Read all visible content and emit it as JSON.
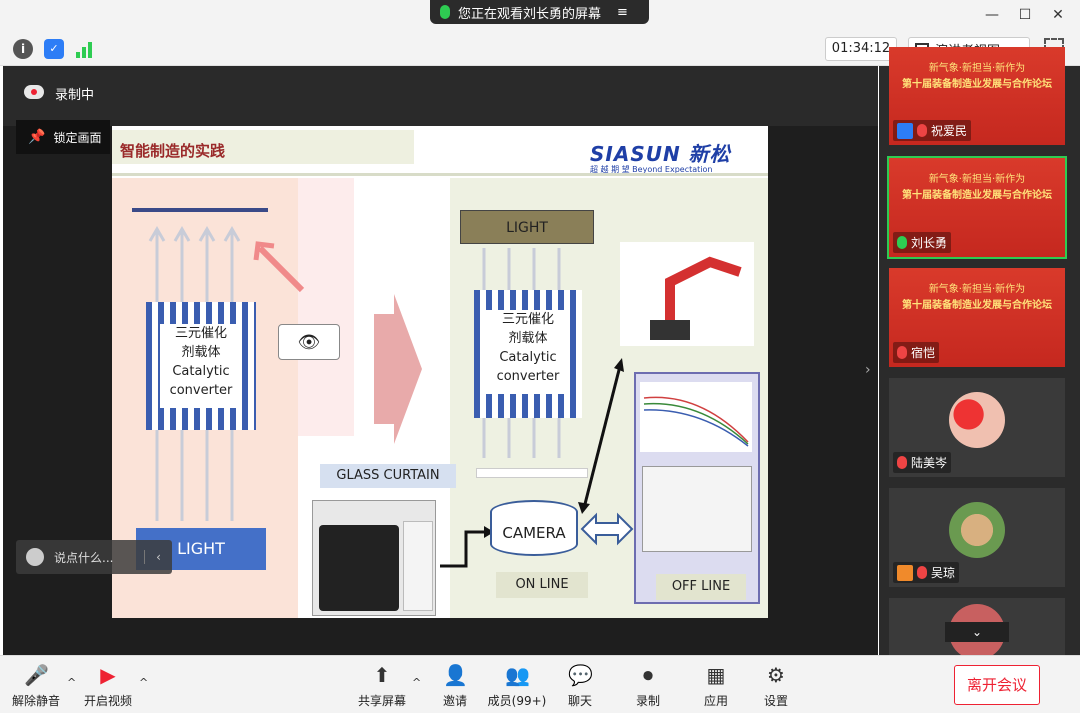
{
  "window": {
    "sharing_text": "您正在观看刘长勇的屏幕",
    "menu_icon": "≡",
    "minimize": "—",
    "maximize": "☐",
    "close": "✕"
  },
  "toolbar": {
    "timer": "01:34:12",
    "view_label": "演讲者视图",
    "info_icon": "i",
    "shield_icon": "✓"
  },
  "overlay": {
    "recording_label": "录制中",
    "lock_label": "锁定画面",
    "chat_placeholder": "说点什么..."
  },
  "slide": {
    "title": "智能制造的实践",
    "logo": "SIASUN 新松",
    "logo_tagline": "超 越 期 望   Beyond Expectation",
    "left_converter": "三元催化\n剂载体\nCatalytic\nconverter",
    "left_light": "LIGHT",
    "right_light": "LIGHT",
    "right_converter": "三元催化\n剂载体\nCatalytic\nconverter",
    "glass_curtain": "GLASS CURTAIN",
    "camera": "CAMERA",
    "on_line": "ON LINE",
    "off_line": "OFF LINE"
  },
  "participants": [
    {
      "name": "祝爱民",
      "banner1": "新气象·新担当·新作为",
      "banner2": "第十届装备制造业发展与合作论坛",
      "active": false,
      "mic": "muted",
      "icon": "blue"
    },
    {
      "name": "刘长勇",
      "banner1": "新气象·新担当·新作为",
      "banner2": "第十届装备制造业发展与合作论坛",
      "active": true,
      "mic": "live",
      "icon": "none"
    },
    {
      "name": "宿恺",
      "banner1": "新气象·新担当·新作为",
      "banner2": "第十届装备制造业发展与合作论坛",
      "active": false,
      "mic": "muted",
      "icon": "none"
    },
    {
      "name": "陆美岑",
      "active": false,
      "mic": "muted",
      "icon": "none"
    },
    {
      "name": "吴琼",
      "active": false,
      "mic": "muted",
      "icon": "orange"
    }
  ],
  "bottom": {
    "unmute": "解除静音",
    "video": "开启视频",
    "share": "共享屏幕",
    "invite": "邀请",
    "members": "成员(99+)",
    "chat": "聊天",
    "record": "录制",
    "apps": "应用",
    "settings": "设置",
    "leave": "离开会议"
  },
  "colors": {
    "accent_green": "#2ecc52",
    "leave_red": "#e23333",
    "slide_blue": "#3a6cc4"
  }
}
